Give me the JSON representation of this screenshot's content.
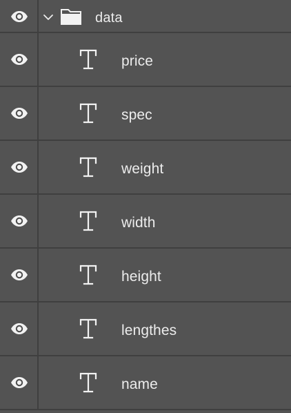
{
  "layers_panel": {
    "group": {
      "name": "data",
      "visible": true,
      "expanded": true,
      "icons": {
        "visibility": "eye-icon",
        "disclosure": "chevron-down-icon",
        "group": "folder-icon"
      }
    },
    "layers": [
      {
        "name": "price",
        "type": "text",
        "visible": true,
        "icon": "text-layer-icon"
      },
      {
        "name": "spec",
        "type": "text",
        "visible": true,
        "icon": "text-layer-icon"
      },
      {
        "name": "weight",
        "type": "text",
        "visible": true,
        "icon": "text-layer-icon"
      },
      {
        "name": "width",
        "type": "text",
        "visible": true,
        "icon": "text-layer-icon"
      },
      {
        "name": "height",
        "type": "text",
        "visible": true,
        "icon": "text-layer-icon"
      },
      {
        "name": "lengthes",
        "type": "text",
        "visible": true,
        "icon": "text-layer-icon"
      },
      {
        "name": "name",
        "type": "text",
        "visible": true,
        "icon": "text-layer-icon"
      }
    ],
    "colors": {
      "panel_background": "#535353",
      "separator": "#3f3f3f",
      "text": "#ececec",
      "icon": "#f2f2f2"
    }
  }
}
